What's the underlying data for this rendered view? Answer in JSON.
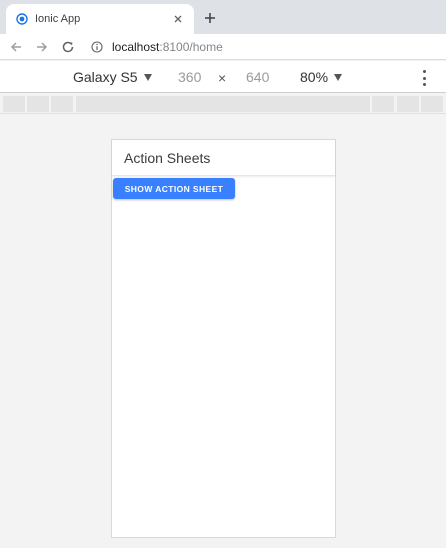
{
  "browser": {
    "tab": {
      "title": "Ionic App",
      "favicon": "ionic-logo-icon"
    },
    "url": {
      "host": "localhost",
      "rest": ":8100/home"
    },
    "icons": [
      "back-arrow-icon",
      "forward-arrow-icon",
      "reload-icon",
      "info-icon",
      "close-icon",
      "plus-icon"
    ]
  },
  "device_toolbar": {
    "device": "Galaxy S5",
    "width": "360",
    "separator": "×",
    "height": "640",
    "zoom": "80%"
  },
  "app": {
    "header_title": "Action Sheets",
    "button_label": "SHOW ACTION SHEET"
  },
  "colors": {
    "tab_strip": "#dee1e6",
    "ionic_primary": "#3880ff",
    "favicon_blue": "#1a73e8"
  }
}
